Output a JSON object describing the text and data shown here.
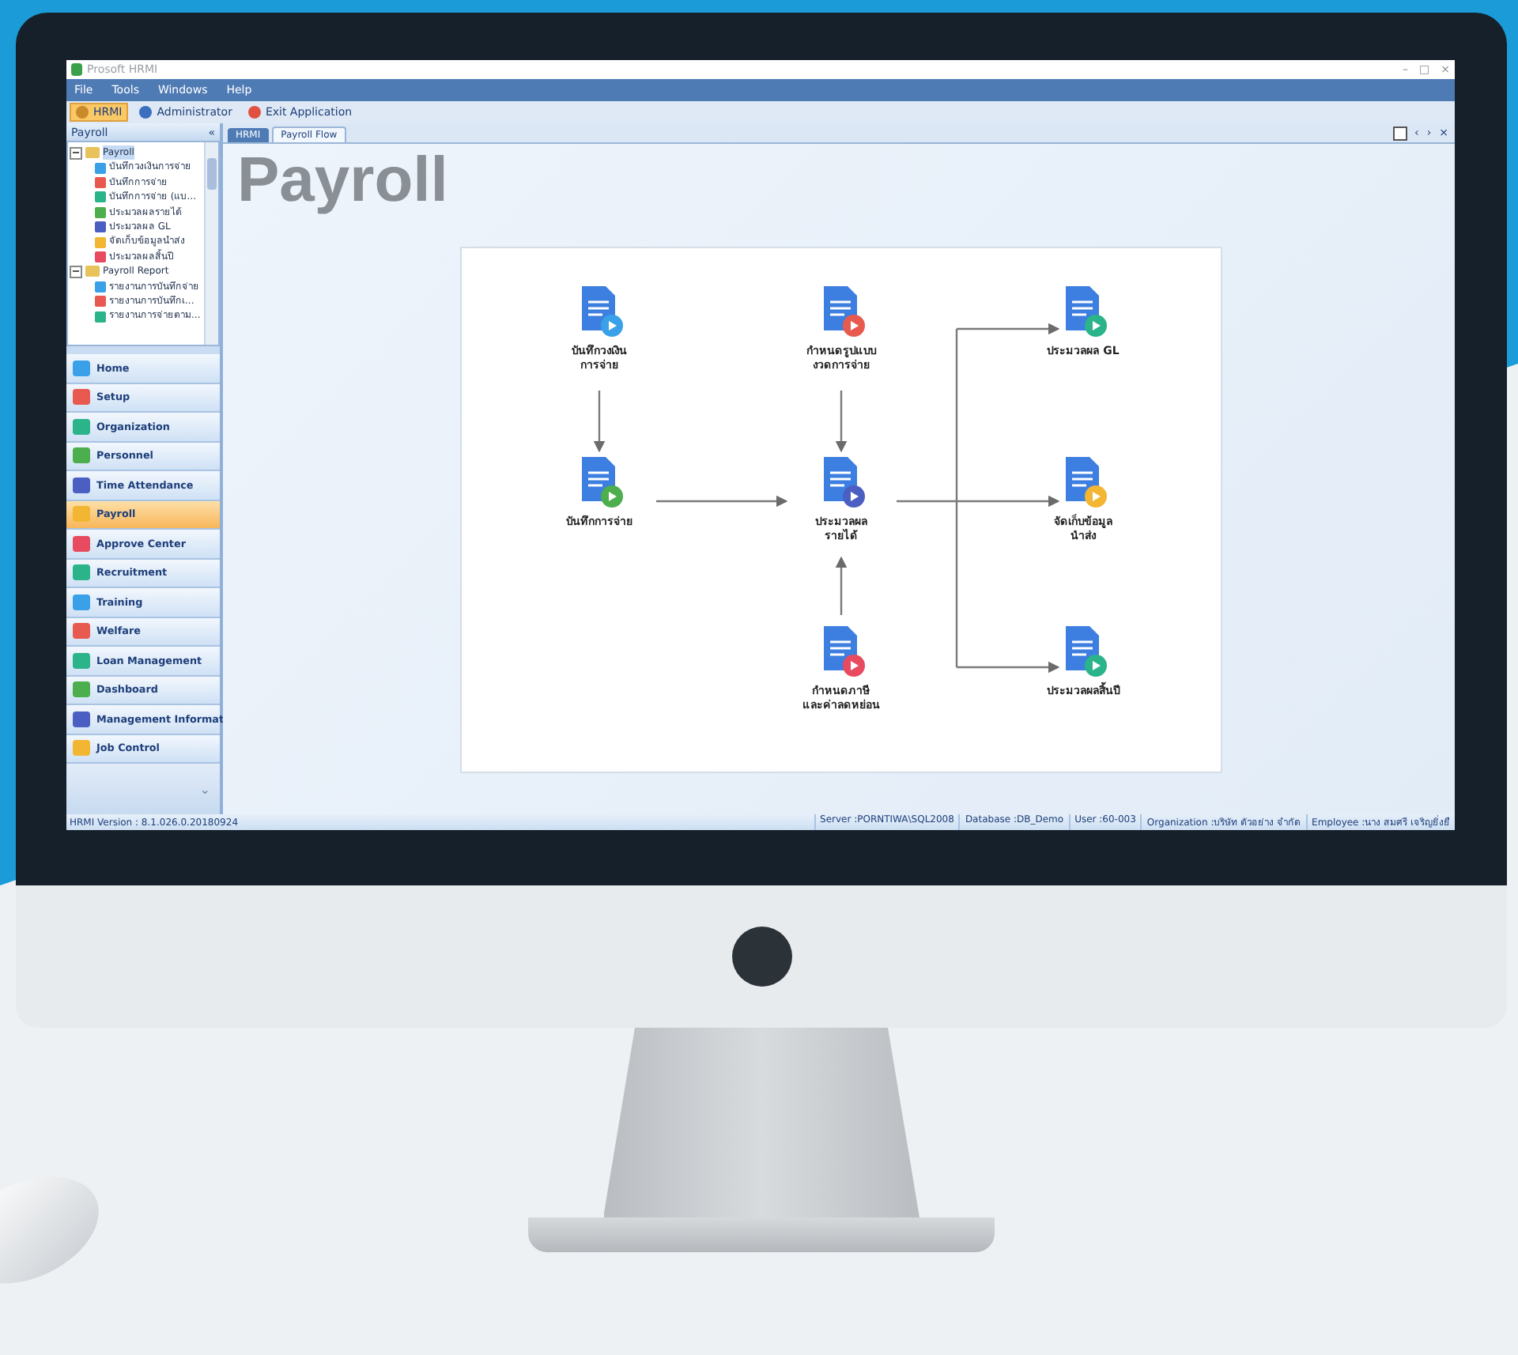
{
  "window": {
    "title": "Prosoft HRMI",
    "controls": [
      "–",
      "□",
      "×"
    ]
  },
  "menu": [
    "File",
    "Tools",
    "Windows",
    "Help"
  ],
  "toolbar": [
    {
      "label": "HRMI",
      "selected": true
    },
    {
      "label": "Administrator",
      "selected": false
    },
    {
      "label": "Exit Application",
      "selected": false
    }
  ],
  "sidebar": {
    "title": "Payroll",
    "collapse": "«",
    "tree": [
      {
        "label": "Payroll",
        "expanded": true,
        "selected": true,
        "children": [
          {
            "label": "บันทึกวงเงินการจ่าย"
          },
          {
            "label": "บันทึกการจ่าย"
          },
          {
            "label": "บันทึกการจ่าย (แบ..."
          },
          {
            "label": "ประมวลผลรายได้"
          },
          {
            "label": "ประมวลผล GL"
          },
          {
            "label": "จัดเก็บข้อมูลนำส่ง"
          },
          {
            "label": "ประมวลผลสิ้นปี"
          }
        ]
      },
      {
        "label": "Payroll Report",
        "expanded": true,
        "selected": false,
        "children": [
          {
            "label": "รายงานการบันทึกจ่าย"
          },
          {
            "label": "รายงานการบันทึกเ..."
          },
          {
            "label": "รายงานการจ่ายตาม..."
          }
        ]
      }
    ],
    "items": [
      {
        "label": "Home",
        "selected": false
      },
      {
        "label": "Setup",
        "selected": false
      },
      {
        "label": "Organization",
        "selected": false
      },
      {
        "label": "Personnel",
        "selected": false
      },
      {
        "label": "Time Attendance",
        "selected": false
      },
      {
        "label": "Payroll",
        "selected": true
      },
      {
        "label": "Approve Center",
        "selected": false
      },
      {
        "label": "Recruitment",
        "selected": false
      },
      {
        "label": "Training",
        "selected": false
      },
      {
        "label": "Welfare",
        "selected": false
      },
      {
        "label": "Loan Management",
        "selected": false
      },
      {
        "label": "Dashboard",
        "selected": false
      },
      {
        "label": "Management Informat",
        "selected": false
      },
      {
        "label": "Job Control",
        "selected": false
      }
    ],
    "more": "⌄"
  },
  "tabs": [
    {
      "label": "HRMI",
      "selected": false
    },
    {
      "label": "Payroll Flow",
      "selected": true
    }
  ],
  "tab_controls": [
    "‹",
    "›",
    "×"
  ],
  "heading": "Payroll",
  "flow": {
    "nodes": [
      {
        "label": "บันทึกวงเงิน\nการจ่าย"
      },
      {
        "label": "กำหนดรูปแบบ\nงวดการจ่าย"
      },
      {
        "label": "ประมวลผล GL"
      },
      {
        "label": "บันทึกการจ่าย"
      },
      {
        "label": "ประมวลผล\nรายได้"
      },
      {
        "label": "จัดเก็บข้อมูล\nนำส่ง"
      },
      {
        "label": "กำหนดภาษี\nและค่าลดหย่อน"
      },
      {
        "label": "ประมวลผลสิ้นปี"
      }
    ]
  },
  "status_bar": {
    "version": "HRMI Version : 8.1.026.0.20180924",
    "fields": [
      "Server :PORNTIWA\\SQL2008",
      "Database :DB_Demo",
      "User :60-003",
      "Organization :บริษัท ตัวอย่าง จำกัด",
      "Employee :นาง สมศรี เจริญยิ่งยื"
    ]
  }
}
